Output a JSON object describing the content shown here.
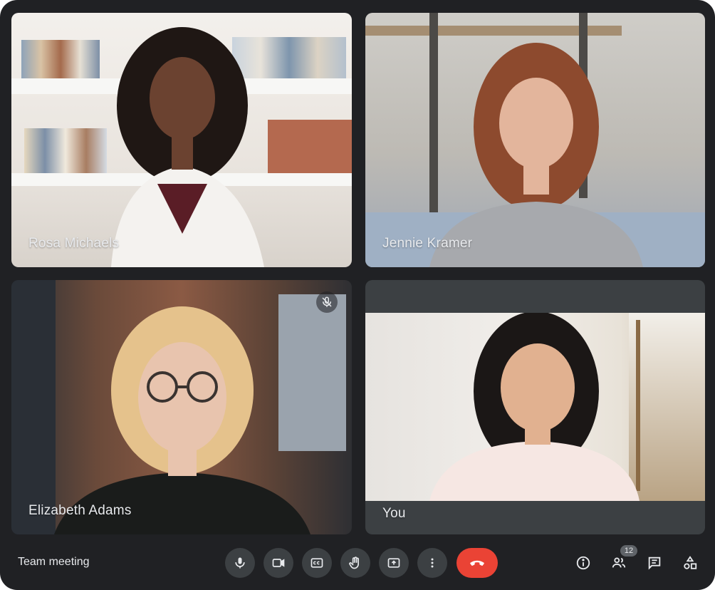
{
  "meeting": {
    "title": "Team meeting",
    "participant_count": "12"
  },
  "tiles": [
    {
      "name": "Rosa Michaels"
    },
    {
      "name": "Jennie Kramer"
    },
    {
      "name": "Elizabeth Adams",
      "muted": true
    },
    {
      "name": "You"
    }
  ],
  "controls": [
    {
      "name": "microphone",
      "icon": "mic-icon"
    },
    {
      "name": "camera",
      "icon": "camera-icon"
    },
    {
      "name": "captions",
      "icon": "captions-icon"
    },
    {
      "name": "raise-hand",
      "icon": "hand-icon"
    },
    {
      "name": "present",
      "icon": "present-icon"
    },
    {
      "name": "more-options",
      "icon": "more-vert-icon"
    },
    {
      "name": "end-call",
      "icon": "phone-hangup-icon"
    }
  ],
  "right_icons": [
    {
      "name": "meeting-details",
      "icon": "info-icon"
    },
    {
      "name": "people",
      "icon": "people-icon"
    },
    {
      "name": "chat",
      "icon": "chat-icon"
    },
    {
      "name": "activities",
      "icon": "shapes-icon"
    }
  ],
  "colors": {
    "background": "#202124",
    "control": "#3c4043",
    "end_call": "#ea4335",
    "text": "#e8eaed"
  }
}
